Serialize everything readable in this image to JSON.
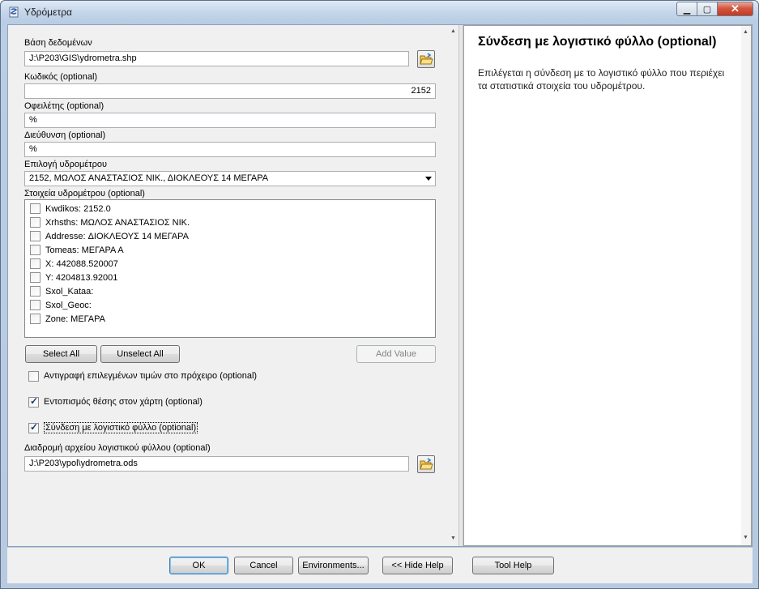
{
  "window": {
    "title": "Υδρόμετρα",
    "close_glyph": "✕",
    "min_glyph": "▁",
    "max_glyph": "▢"
  },
  "form": {
    "database_label": "Βάση δεδομένων",
    "database_value": "J:\\P203\\GIS\\ydrometra.shp",
    "code_label": "Κωδικός (optional)",
    "code_value": "2152",
    "debtor_label": "Οφειλέτης (optional)",
    "debtor_value": "%",
    "address_label": "Διεύθυνση (optional)",
    "address_value": "%",
    "meter_select_label": "Επιλογή υδρομέτρου",
    "meter_select_value": "2152, ΜΩΛΟΣ ΑΝΑΣΤΑΣΙΟΣ ΝΙΚ., ΔΙΟΚΛΕΟΥΣ 14 ΜΕΓΑΡΑ",
    "meter_data_label": "Στοιχεία υδρομέτρου (optional)",
    "meter_data_items": [
      {
        "label": "Kwdikos: 2152.0",
        "checked": false
      },
      {
        "label": "Xrhsths: ΜΩΛΟΣ ΑΝΑΣΤΑΣΙΟΣ ΝΙΚ.",
        "checked": false
      },
      {
        "label": "Addresse: ΔΙΟΚΛΕΟΥΣ 14 ΜΕΓΑΡΑ",
        "checked": false
      },
      {
        "label": "Tomeas: ΜΕΓΑΡΑ Α",
        "checked": false
      },
      {
        "label": "X: 442088.520007",
        "checked": false
      },
      {
        "label": "Y: 4204813.92001",
        "checked": false
      },
      {
        "label": "Sxol_Kataa:",
        "checked": false
      },
      {
        "label": "Sxol_Geoc:",
        "checked": false
      },
      {
        "label": "Zone: ΜΕΓΑΡΑ",
        "checked": false
      }
    ],
    "select_all": "Select All",
    "unselect_all": "Unselect All",
    "add_value": "Add Value",
    "copy_option": {
      "label": "Αντιγραφή επιλεγμένων τιμών στο πρόχειρο (optional)",
      "checked": false
    },
    "locate_option": {
      "label": "Εντοπισμός θέσης στον χάρτη (optional)",
      "checked": true
    },
    "link_option": {
      "label": "Σύνδεση με λογιστικό φύλλο (optional)",
      "checked": true
    },
    "spreadsheet_path_label": "Διαδρομή αρχείου λογιστικού φύλλου (optional)",
    "spreadsheet_path_value": "J:\\P203\\ypol\\ydrometra.ods"
  },
  "help": {
    "title": "Σύνδεση με λογιστικό φύλλο (optional)",
    "body": "Επιλέγεται η σύνδεση με το λογιστικό φύλλο που περιέχει τα στατιστικά στοιχεία του υδρομέτρου."
  },
  "footer": {
    "ok": "OK",
    "cancel": "Cancel",
    "environments": "Environments...",
    "hide_help": "<< Hide Help",
    "tool_help": "Tool Help"
  },
  "icons": {
    "folder": "folder-open-icon",
    "app": "arctoolbox-script-icon"
  }
}
